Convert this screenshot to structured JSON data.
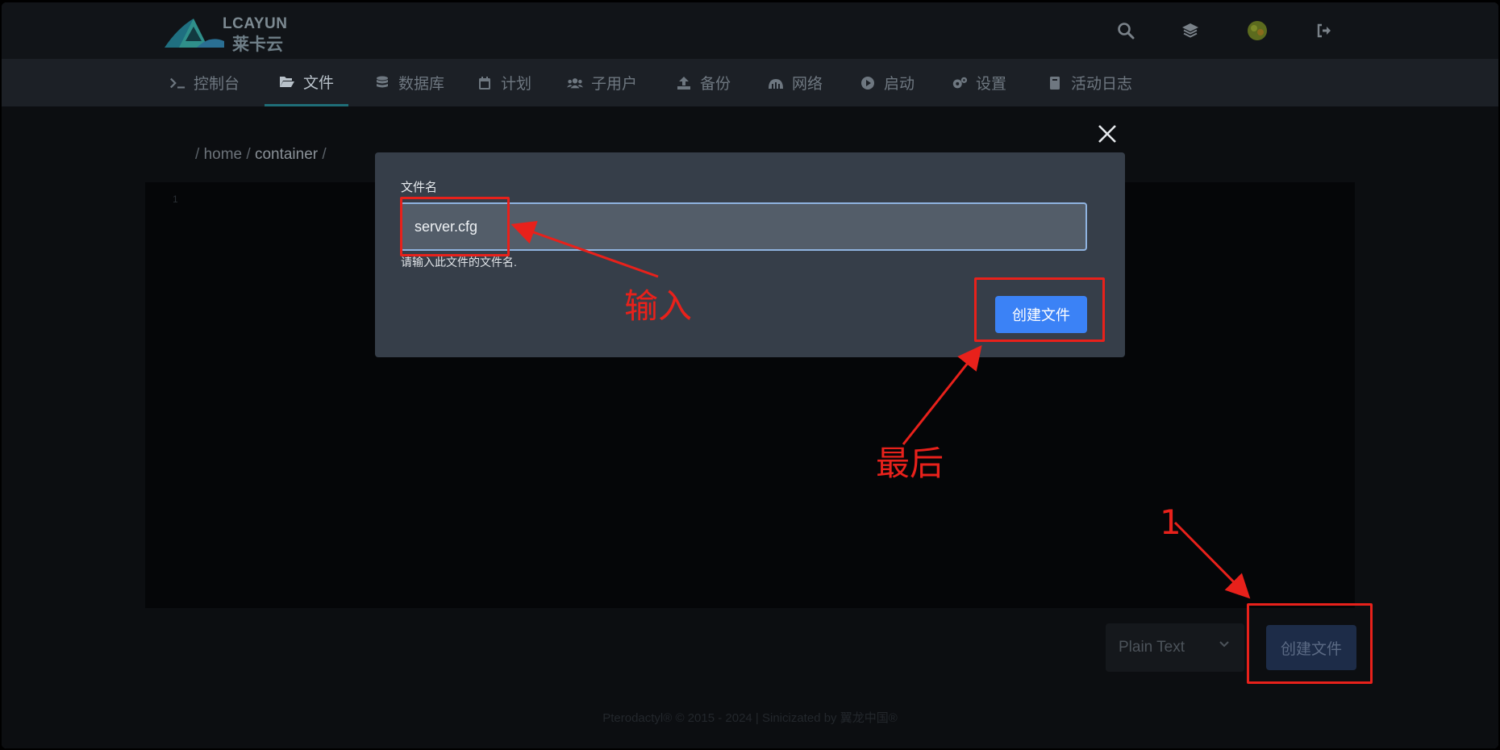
{
  "logo": {
    "text_en": "LCAYUN",
    "text_cn": "莱卡云"
  },
  "topbar_icons": [
    "search-icon",
    "layers-icon",
    "avatar",
    "logout-icon"
  ],
  "nav": {
    "items": [
      {
        "label": "控制台",
        "icon": "terminal-icon"
      },
      {
        "label": "文件",
        "icon": "folder-open-icon",
        "active": true
      },
      {
        "label": "数据库",
        "icon": "database-icon"
      },
      {
        "label": "计划",
        "icon": "calendar-icon"
      },
      {
        "label": "子用户",
        "icon": "users-icon"
      },
      {
        "label": "备份",
        "icon": "upload-icon"
      },
      {
        "label": "网络",
        "icon": "network-icon"
      },
      {
        "label": "启动",
        "icon": "play-circle-icon"
      },
      {
        "label": "设置",
        "icon": "cogs-icon"
      },
      {
        "label": "活动日志",
        "icon": "book-icon"
      }
    ]
  },
  "breadcrumb": {
    "sep1": "/",
    "dir": "home",
    "sep2": "/",
    "current": "container",
    "sep3": "/"
  },
  "editor": {
    "gutter": "1"
  },
  "language_select": {
    "value": "Plain Text"
  },
  "bottom_create_button": "创建文件",
  "footer": "Pterodactyl® © 2015 - 2024 | Sinicizated by 翼龙中国®",
  "modal": {
    "field_label": "文件名",
    "field_value": "server.cfg",
    "field_hint": "请输入此文件的文件名.",
    "submit_label": "创建文件"
  },
  "annotations": {
    "input_note": "输入",
    "last_note": "最后",
    "step_one": "1"
  },
  "colors": {
    "accent": "#3b82f6",
    "annotation": "#e8211b",
    "active_tab_underline": "#1f6e78"
  }
}
